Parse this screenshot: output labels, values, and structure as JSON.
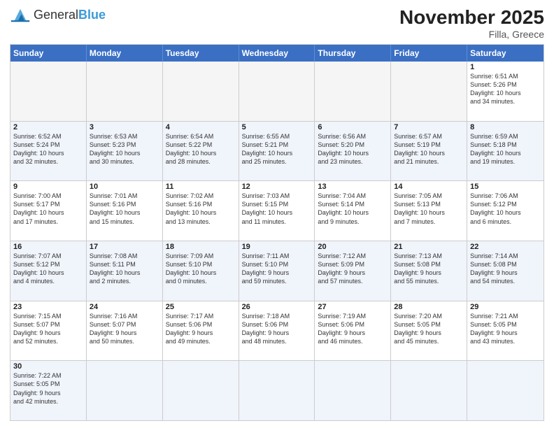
{
  "header": {
    "logo_general": "General",
    "logo_blue": "Blue",
    "month_title": "November 2025",
    "location": "Filla, Greece"
  },
  "day_headers": [
    "Sunday",
    "Monday",
    "Tuesday",
    "Wednesday",
    "Thursday",
    "Friday",
    "Saturday"
  ],
  "weeks": [
    {
      "alt": false,
      "days": [
        {
          "num": "",
          "info": "",
          "empty": true
        },
        {
          "num": "",
          "info": "",
          "empty": true
        },
        {
          "num": "",
          "info": "",
          "empty": true
        },
        {
          "num": "",
          "info": "",
          "empty": true
        },
        {
          "num": "",
          "info": "",
          "empty": true
        },
        {
          "num": "",
          "info": "",
          "empty": true
        },
        {
          "num": "1",
          "info": "Sunrise: 6:51 AM\nSunset: 5:26 PM\nDaylight: 10 hours\nand 34 minutes.",
          "empty": false
        }
      ]
    },
    {
      "alt": true,
      "days": [
        {
          "num": "2",
          "info": "Sunrise: 6:52 AM\nSunset: 5:24 PM\nDaylight: 10 hours\nand 32 minutes.",
          "empty": false
        },
        {
          "num": "3",
          "info": "Sunrise: 6:53 AM\nSunset: 5:23 PM\nDaylight: 10 hours\nand 30 minutes.",
          "empty": false
        },
        {
          "num": "4",
          "info": "Sunrise: 6:54 AM\nSunset: 5:22 PM\nDaylight: 10 hours\nand 28 minutes.",
          "empty": false
        },
        {
          "num": "5",
          "info": "Sunrise: 6:55 AM\nSunset: 5:21 PM\nDaylight: 10 hours\nand 25 minutes.",
          "empty": false
        },
        {
          "num": "6",
          "info": "Sunrise: 6:56 AM\nSunset: 5:20 PM\nDaylight: 10 hours\nand 23 minutes.",
          "empty": false
        },
        {
          "num": "7",
          "info": "Sunrise: 6:57 AM\nSunset: 5:19 PM\nDaylight: 10 hours\nand 21 minutes.",
          "empty": false
        },
        {
          "num": "8",
          "info": "Sunrise: 6:59 AM\nSunset: 5:18 PM\nDaylight: 10 hours\nand 19 minutes.",
          "empty": false
        }
      ]
    },
    {
      "alt": false,
      "days": [
        {
          "num": "9",
          "info": "Sunrise: 7:00 AM\nSunset: 5:17 PM\nDaylight: 10 hours\nand 17 minutes.",
          "empty": false
        },
        {
          "num": "10",
          "info": "Sunrise: 7:01 AM\nSunset: 5:16 PM\nDaylight: 10 hours\nand 15 minutes.",
          "empty": false
        },
        {
          "num": "11",
          "info": "Sunrise: 7:02 AM\nSunset: 5:16 PM\nDaylight: 10 hours\nand 13 minutes.",
          "empty": false
        },
        {
          "num": "12",
          "info": "Sunrise: 7:03 AM\nSunset: 5:15 PM\nDaylight: 10 hours\nand 11 minutes.",
          "empty": false
        },
        {
          "num": "13",
          "info": "Sunrise: 7:04 AM\nSunset: 5:14 PM\nDaylight: 10 hours\nand 9 minutes.",
          "empty": false
        },
        {
          "num": "14",
          "info": "Sunrise: 7:05 AM\nSunset: 5:13 PM\nDaylight: 10 hours\nand 7 minutes.",
          "empty": false
        },
        {
          "num": "15",
          "info": "Sunrise: 7:06 AM\nSunset: 5:12 PM\nDaylight: 10 hours\nand 6 minutes.",
          "empty": false
        }
      ]
    },
    {
      "alt": true,
      "days": [
        {
          "num": "16",
          "info": "Sunrise: 7:07 AM\nSunset: 5:12 PM\nDaylight: 10 hours\nand 4 minutes.",
          "empty": false
        },
        {
          "num": "17",
          "info": "Sunrise: 7:08 AM\nSunset: 5:11 PM\nDaylight: 10 hours\nand 2 minutes.",
          "empty": false
        },
        {
          "num": "18",
          "info": "Sunrise: 7:09 AM\nSunset: 5:10 PM\nDaylight: 10 hours\nand 0 minutes.",
          "empty": false
        },
        {
          "num": "19",
          "info": "Sunrise: 7:11 AM\nSunset: 5:10 PM\nDaylight: 9 hours\nand 59 minutes.",
          "empty": false
        },
        {
          "num": "20",
          "info": "Sunrise: 7:12 AM\nSunset: 5:09 PM\nDaylight: 9 hours\nand 57 minutes.",
          "empty": false
        },
        {
          "num": "21",
          "info": "Sunrise: 7:13 AM\nSunset: 5:08 PM\nDaylight: 9 hours\nand 55 minutes.",
          "empty": false
        },
        {
          "num": "22",
          "info": "Sunrise: 7:14 AM\nSunset: 5:08 PM\nDaylight: 9 hours\nand 54 minutes.",
          "empty": false
        }
      ]
    },
    {
      "alt": false,
      "days": [
        {
          "num": "23",
          "info": "Sunrise: 7:15 AM\nSunset: 5:07 PM\nDaylight: 9 hours\nand 52 minutes.",
          "empty": false
        },
        {
          "num": "24",
          "info": "Sunrise: 7:16 AM\nSunset: 5:07 PM\nDaylight: 9 hours\nand 50 minutes.",
          "empty": false
        },
        {
          "num": "25",
          "info": "Sunrise: 7:17 AM\nSunset: 5:06 PM\nDaylight: 9 hours\nand 49 minutes.",
          "empty": false
        },
        {
          "num": "26",
          "info": "Sunrise: 7:18 AM\nSunset: 5:06 PM\nDaylight: 9 hours\nand 48 minutes.",
          "empty": false
        },
        {
          "num": "27",
          "info": "Sunrise: 7:19 AM\nSunset: 5:06 PM\nDaylight: 9 hours\nand 46 minutes.",
          "empty": false
        },
        {
          "num": "28",
          "info": "Sunrise: 7:20 AM\nSunset: 5:05 PM\nDaylight: 9 hours\nand 45 minutes.",
          "empty": false
        },
        {
          "num": "29",
          "info": "Sunrise: 7:21 AM\nSunset: 5:05 PM\nDaylight: 9 hours\nand 43 minutes.",
          "empty": false
        }
      ]
    },
    {
      "alt": true,
      "days": [
        {
          "num": "30",
          "info": "Sunrise: 7:22 AM\nSunset: 5:05 PM\nDaylight: 9 hours\nand 42 minutes.",
          "empty": false
        },
        {
          "num": "",
          "info": "",
          "empty": true
        },
        {
          "num": "",
          "info": "",
          "empty": true
        },
        {
          "num": "",
          "info": "",
          "empty": true
        },
        {
          "num": "",
          "info": "",
          "empty": true
        },
        {
          "num": "",
          "info": "",
          "empty": true
        },
        {
          "num": "",
          "info": "",
          "empty": true
        }
      ]
    }
  ]
}
